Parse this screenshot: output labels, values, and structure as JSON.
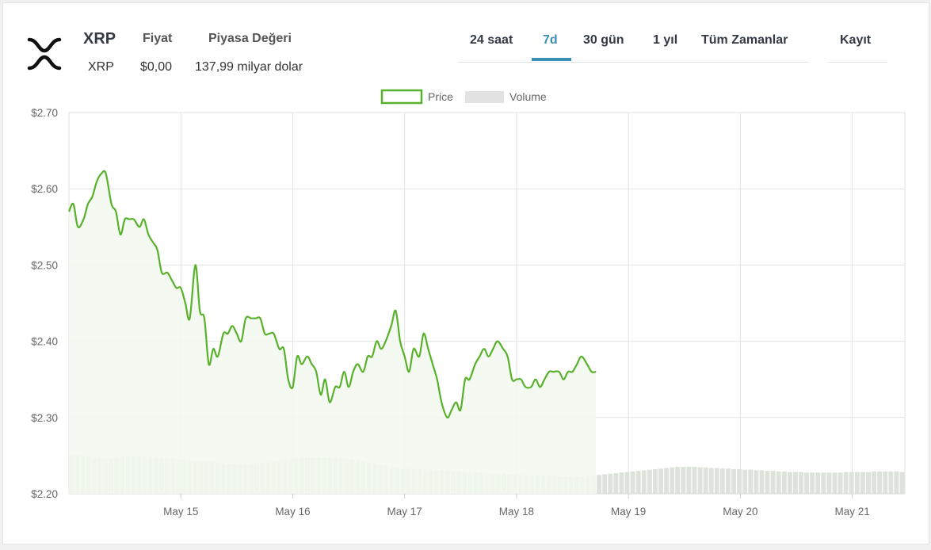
{
  "header": {
    "symbol": "XRP",
    "name": "XRP",
    "price_label": "Fiyat",
    "price_value": "$0,00",
    "mcap_label": "Piyasa Değeri",
    "mcap_value": "137,99 milyar dolar",
    "logo_icon": "xrp-logo-icon"
  },
  "tabs": [
    {
      "label": "24 saat",
      "active": false
    },
    {
      "label": "7d",
      "active": true
    },
    {
      "label": "30 gün",
      "active": false
    },
    {
      "label": "1 yıl",
      "active": false
    },
    {
      "label": "Tüm Zamanlar",
      "active": false
    }
  ],
  "register_label": "Kayıt",
  "colors": {
    "accent": "#3a8fb7",
    "price_line": "#58b12a",
    "price_fill": "#f2f9ee",
    "volume": "#dde2da",
    "text": "#333a45"
  },
  "chart_data": {
    "type": "line",
    "legend": [
      {
        "name": "Price",
        "kind": "line"
      },
      {
        "name": "Volume",
        "kind": "bar"
      }
    ],
    "legend_position": "top-center",
    "grid": true,
    "ylim": [
      2.2,
      2.7
    ],
    "y_ticks": [
      "$2.70",
      "$2.60",
      "$2.50",
      "$2.40",
      "$2.30",
      "$2.20"
    ],
    "x_ticks": [
      "May 15",
      "May 16",
      "May 17",
      "May 18",
      "May 19",
      "May 20",
      "May 21"
    ],
    "x_range_days": [
      14.0,
      21.47
    ],
    "series": [
      {
        "name": "Price",
        "x_days": [
          14.0,
          14.04,
          14.08,
          14.13,
          14.17,
          14.21,
          14.25,
          14.29,
          14.33,
          14.38,
          14.42,
          14.46,
          14.5,
          14.54,
          14.58,
          14.63,
          14.67,
          14.71,
          14.75,
          14.79,
          14.83,
          14.88,
          14.92,
          14.96,
          15.0,
          15.04,
          15.08,
          15.13,
          15.17,
          15.21,
          15.25,
          15.29,
          15.33,
          15.38,
          15.42,
          15.46,
          15.5,
          15.54,
          15.58,
          15.63,
          15.67,
          15.71,
          15.75,
          15.79,
          15.83,
          15.88,
          15.92,
          15.96,
          16.0,
          16.04,
          16.08,
          16.13,
          16.17,
          16.21,
          16.25,
          16.29,
          16.33,
          16.38,
          16.42,
          16.46,
          16.5,
          16.54,
          16.58,
          16.63,
          16.67,
          16.71,
          16.75,
          16.79,
          16.83,
          16.88,
          16.92,
          16.96,
          17.0,
          17.04,
          17.08,
          17.13,
          17.17,
          17.21,
          17.25,
          17.29,
          17.33,
          17.38,
          17.42,
          17.46,
          17.5,
          17.54,
          17.58,
          17.63,
          17.67,
          17.71,
          17.75,
          17.79,
          17.83,
          17.88,
          17.92,
          17.96,
          18.0,
          18.04,
          18.08,
          18.13,
          18.17,
          18.21,
          18.25,
          18.29,
          18.33,
          18.38,
          18.42,
          18.46,
          18.5,
          18.54,
          18.58,
          18.63,
          18.67,
          18.71,
          18.75,
          18.79,
          18.83,
          18.88,
          18.92,
          18.96,
          19.0,
          19.04,
          19.08,
          19.13,
          19.17,
          19.21,
          19.25,
          19.29,
          19.33,
          19.38,
          19.42,
          19.46,
          19.5,
          19.54,
          19.58,
          19.63,
          19.67,
          19.71,
          19.75,
          19.79,
          19.83,
          19.88,
          19.92,
          19.96,
          20.0,
          20.04,
          20.08,
          20.13,
          20.17,
          20.21,
          20.25,
          20.29,
          20.33,
          20.38,
          20.42,
          20.46,
          20.5,
          20.54,
          20.58,
          20.63,
          20.67,
          20.71,
          20.75,
          20.79,
          20.83,
          20.88,
          20.92,
          20.96,
          21.0,
          21.04,
          21.08,
          21.13,
          21.17,
          21.21,
          21.25,
          21.29,
          21.33,
          21.38,
          21.42,
          21.47
        ],
        "values": [
          2.57,
          2.58,
          2.55,
          2.56,
          2.58,
          2.59,
          2.61,
          2.62,
          2.62,
          2.58,
          2.57,
          2.54,
          2.56,
          2.56,
          2.56,
          2.55,
          2.56,
          2.54,
          2.53,
          2.52,
          2.49,
          2.49,
          2.48,
          2.47,
          2.47,
          2.45,
          2.43,
          2.5,
          2.44,
          2.43,
          2.37,
          2.39,
          2.38,
          2.41,
          2.41,
          2.42,
          2.41,
          2.4,
          2.43,
          2.43,
          2.43,
          2.43,
          2.41,
          2.41,
          2.41,
          2.39,
          2.39,
          2.35,
          2.34,
          2.38,
          2.37,
          2.38,
          2.37,
          2.36,
          2.33,
          2.35,
          2.32,
          2.34,
          2.34,
          2.36,
          2.34,
          2.36,
          2.37,
          2.36,
          2.38,
          2.38,
          2.4,
          2.39,
          2.4,
          2.42,
          2.44,
          2.4,
          2.38,
          2.36,
          2.39,
          2.38,
          2.41,
          2.39,
          2.37,
          2.35,
          2.32,
          2.3,
          2.31,
          2.32,
          2.31,
          2.35,
          2.35,
          2.37,
          2.38,
          2.39,
          2.38,
          2.39,
          2.4,
          2.39,
          2.38,
          2.35,
          2.35,
          2.35,
          2.34,
          2.34,
          2.35,
          2.34,
          2.35,
          2.36,
          2.36,
          2.36,
          2.35,
          2.36,
          2.36,
          2.37,
          2.38,
          2.37,
          2.36,
          2.36
        ]
      },
      {
        "name": "Volume",
        "values_relative": [
          0.68,
          0.67,
          0.66,
          0.65,
          0.63,
          0.62,
          0.61,
          0.61,
          0.63,
          0.65,
          0.66,
          0.66,
          0.65,
          0.65,
          0.64,
          0.63,
          0.63,
          0.62,
          0.61,
          0.6,
          0.6,
          0.59,
          0.58,
          0.57,
          0.56,
          0.56,
          0.55,
          0.53,
          0.52,
          0.52,
          0.51,
          0.51,
          0.52,
          0.53,
          0.54,
          0.55,
          0.57,
          0.58,
          0.6,
          0.61,
          0.62,
          0.63,
          0.64,
          0.64,
          0.64,
          0.64,
          0.63,
          0.63,
          0.62,
          0.61,
          0.6,
          0.59,
          0.57,
          0.55,
          0.53,
          0.51,
          0.49,
          0.47,
          0.45,
          0.44,
          0.44,
          0.43,
          0.43,
          0.42,
          0.42,
          0.41,
          0.41,
          0.4,
          0.39,
          0.39,
          0.38,
          0.38,
          0.37,
          0.37,
          0.36,
          0.36,
          0.35,
          0.35,
          0.34,
          0.34,
          0.33,
          0.33,
          0.32,
          0.32,
          0.31,
          0.31,
          0.31,
          0.3,
          0.3,
          0.3,
          0.3,
          0.3,
          0.31,
          0.32,
          0.33,
          0.34,
          0.35,
          0.36,
          0.37,
          0.38,
          0.39,
          0.4,
          0.41,
          0.42,
          0.43,
          0.44,
          0.45,
          0.46,
          0.47,
          0.47,
          0.47,
          0.47,
          0.46,
          0.46,
          0.45,
          0.45,
          0.44,
          0.44,
          0.43,
          0.43,
          0.42,
          0.42,
          0.41,
          0.41,
          0.4,
          0.4,
          0.39,
          0.39,
          0.38,
          0.38,
          0.38,
          0.37,
          0.37,
          0.37,
          0.37,
          0.37,
          0.37,
          0.37,
          0.38,
          0.38,
          0.38,
          0.38,
          0.38,
          0.39,
          0.39,
          0.39,
          0.39,
          0.39,
          0.38
        ]
      }
    ]
  }
}
